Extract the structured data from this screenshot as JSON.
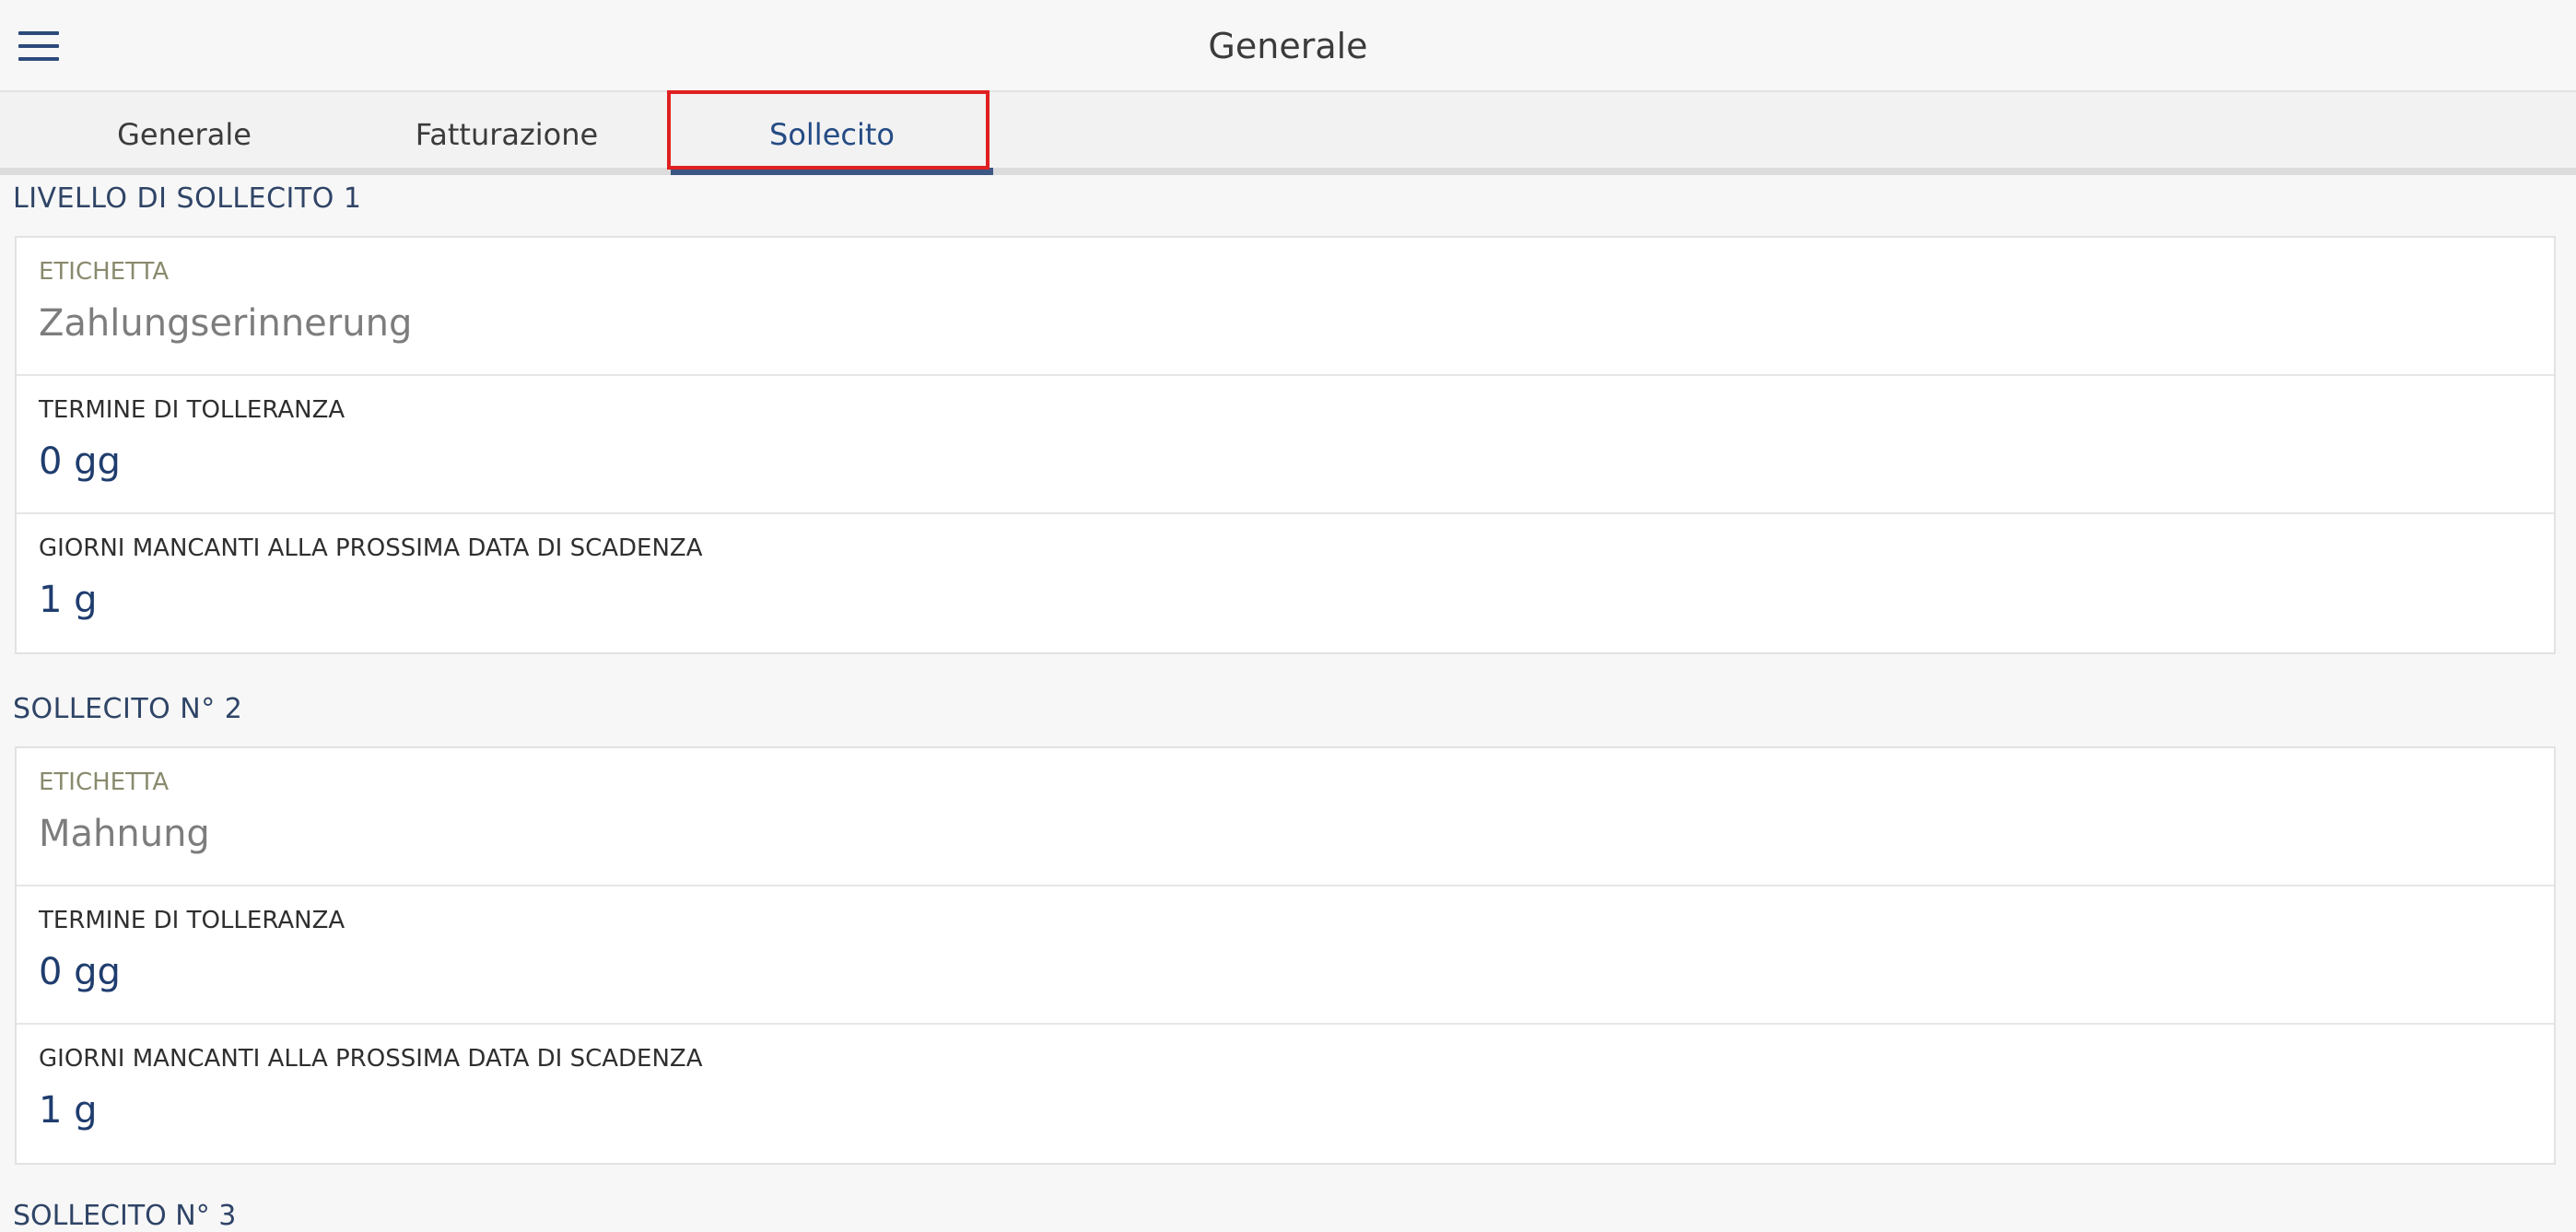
{
  "header": {
    "title": "Generale",
    "menu_icon": "hamburger-menu-icon"
  },
  "tabs": [
    {
      "label": "Generale",
      "active": false
    },
    {
      "label": "Fatturazione",
      "active": false
    },
    {
      "label": "Sollecito",
      "active": true
    }
  ],
  "sections": [
    {
      "title": "LIVELLO DI SOLLECITO 1",
      "fields": [
        {
          "label": "ETICHETTA",
          "value": "Zahlungserinnerung"
        },
        {
          "label": "TERMINE DI TOLLERANZA",
          "value": "0 gg"
        },
        {
          "label": "GIORNI MANCANTI ALLA PROSSIMA DATA DI SCADENZA",
          "value": "1 g"
        }
      ]
    },
    {
      "title": "SOLLECITO N° 2",
      "fields": [
        {
          "label": "ETICHETTA",
          "value": "Mahnung"
        },
        {
          "label": "TERMINE DI TOLLERANZA",
          "value": "0 gg"
        },
        {
          "label": "GIORNI MANCANTI ALLA PROSSIMA DATA DI SCADENZA",
          "value": "1 g"
        }
      ]
    },
    {
      "title": "SOLLECITO N° 3"
    }
  ],
  "colors": {
    "accent": "#244b84",
    "highlight": "#e02020"
  }
}
